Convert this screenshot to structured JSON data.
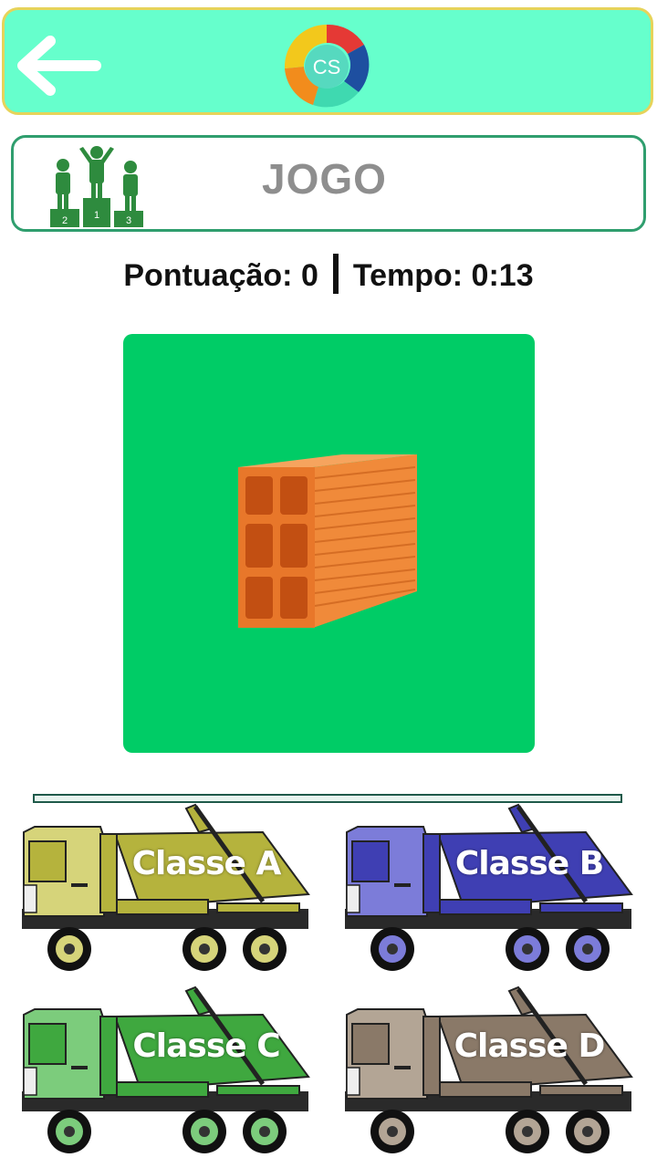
{
  "header": {
    "logo_text": "CS"
  },
  "game_banner": {
    "title": "JOGO",
    "podium_places": [
      "2",
      "1",
      "3"
    ]
  },
  "status": {
    "score_label": "Pontuação: 0",
    "time_label": "Tempo: 0:13"
  },
  "item_card": {
    "item": "brick",
    "bg_color": "#00cc66"
  },
  "trucks": [
    {
      "label": "Classe A",
      "color": "#b5b33d",
      "light": "#d6d47a"
    },
    {
      "label": "Classe B",
      "color": "#3f3fb3",
      "light": "#7c7cd9"
    },
    {
      "label": "Classe C",
      "color": "#3fa83f",
      "light": "#7ccc7c"
    },
    {
      "label": "Classe D",
      "color": "#8a7968",
      "light": "#b3a595"
    }
  ]
}
